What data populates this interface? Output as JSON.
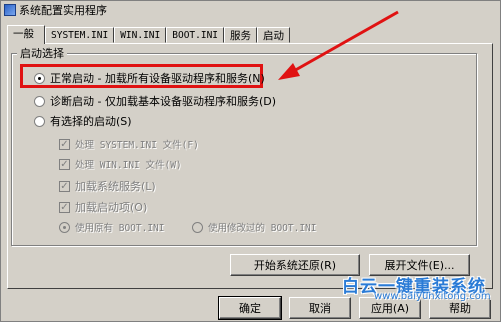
{
  "window": {
    "title": "系统配置实用程序"
  },
  "tabs": [
    {
      "label": "一般",
      "active": true
    },
    {
      "label": "SYSTEM.INI"
    },
    {
      "label": "WIN.INI"
    },
    {
      "label": "BOOT.INI"
    },
    {
      "label": "服务"
    },
    {
      "label": "启动"
    }
  ],
  "startup": {
    "group_label": "启动选择",
    "normal": "正常启动 - 加载所有设备驱动程序和服务(N)",
    "diagnostic": "诊断启动 - 仅加载基本设备驱动程序和服务(D)",
    "selective": "有选择的启动(S)",
    "options": {
      "system_ini": "处理 SYSTEM.INI 文件(F)",
      "win_ini": "处理 WIN.INI 文件(W)",
      "services": "加载系统服务(L)",
      "startup_items": "加载启动项(O)",
      "use_original_boot": "使用原有 BOOT.INI",
      "use_modified_boot": "使用修改过的 BOOT.INI"
    }
  },
  "buttons": {
    "restore": "开始系统还原(R)",
    "expand": "展开文件(E)...",
    "ok": "确定",
    "cancel": "取消",
    "apply": "应用(A)",
    "help": "帮助"
  },
  "watermark": {
    "title": "白云一键重装系统",
    "url": "www.baiyunxitong.com"
  },
  "colors": {
    "highlight": "#e01212",
    "watermark": "#2a7bd6"
  },
  "icons": {
    "title": "app-icon",
    "check": "✓"
  }
}
